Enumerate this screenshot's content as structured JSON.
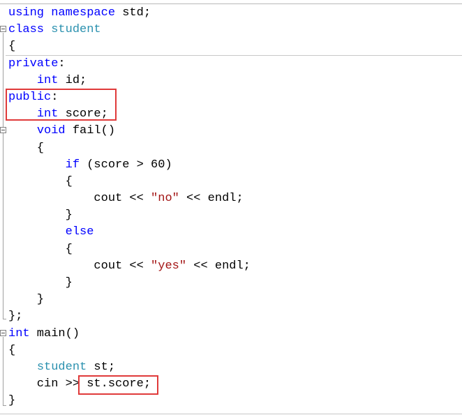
{
  "editor": {
    "lines": [
      {
        "tokens": [
          {
            "t": "using namespace",
            "c": "kw"
          },
          {
            "t": " std;",
            "c": "plain"
          }
        ]
      },
      {
        "tokens": [
          {
            "t": "class",
            "c": "kw"
          },
          {
            "t": " ",
            "c": "plain"
          },
          {
            "t": "student",
            "c": "type"
          }
        ]
      },
      {
        "tokens": [
          {
            "t": "{",
            "c": "plain"
          }
        ]
      },
      {
        "tokens": [
          {
            "t": "private",
            "c": "kw"
          },
          {
            "t": ":",
            "c": "plain"
          }
        ]
      },
      {
        "tokens": [
          {
            "t": "    ",
            "c": "plain"
          },
          {
            "t": "int",
            "c": "kw"
          },
          {
            "t": " id;",
            "c": "plain"
          }
        ]
      },
      {
        "tokens": [
          {
            "t": "public",
            "c": "kw"
          },
          {
            "t": ":",
            "c": "plain"
          }
        ]
      },
      {
        "tokens": [
          {
            "t": "    ",
            "c": "plain"
          },
          {
            "t": "int",
            "c": "kw"
          },
          {
            "t": " score;",
            "c": "plain"
          }
        ]
      },
      {
        "tokens": [
          {
            "t": "    ",
            "c": "plain"
          },
          {
            "t": "void",
            "c": "kw"
          },
          {
            "t": " fail()",
            "c": "plain"
          }
        ]
      },
      {
        "tokens": [
          {
            "t": "    {",
            "c": "plain"
          }
        ]
      },
      {
        "tokens": [
          {
            "t": "        ",
            "c": "plain"
          },
          {
            "t": "if",
            "c": "kw"
          },
          {
            "t": " (score > 60)",
            "c": "plain"
          }
        ]
      },
      {
        "tokens": [
          {
            "t": "        {",
            "c": "plain"
          }
        ]
      },
      {
        "tokens": [
          {
            "t": "            cout << ",
            "c": "plain"
          },
          {
            "t": "\"no\"",
            "c": "str"
          },
          {
            "t": " << endl;",
            "c": "plain"
          }
        ]
      },
      {
        "tokens": [
          {
            "t": "        }",
            "c": "plain"
          }
        ]
      },
      {
        "tokens": [
          {
            "t": "        ",
            "c": "plain"
          },
          {
            "t": "else",
            "c": "kw"
          }
        ]
      },
      {
        "tokens": [
          {
            "t": "        {",
            "c": "plain"
          }
        ]
      },
      {
        "tokens": [
          {
            "t": "            cout << ",
            "c": "plain"
          },
          {
            "t": "\"yes\"",
            "c": "str"
          },
          {
            "t": " << endl;",
            "c": "plain"
          }
        ]
      },
      {
        "tokens": [
          {
            "t": "        }",
            "c": "plain"
          }
        ]
      },
      {
        "tokens": [
          {
            "t": "    }",
            "c": "plain"
          }
        ]
      },
      {
        "tokens": [
          {
            "t": "};",
            "c": "plain"
          }
        ]
      },
      {
        "tokens": [
          {
            "t": "int",
            "c": "kw"
          },
          {
            "t": " main()",
            "c": "plain"
          }
        ]
      },
      {
        "tokens": [
          {
            "t": "{",
            "c": "plain"
          }
        ]
      },
      {
        "tokens": [
          {
            "t": "    ",
            "c": "plain"
          },
          {
            "t": "student",
            "c": "type"
          },
          {
            "t": " st;",
            "c": "plain"
          }
        ]
      },
      {
        "tokens": [
          {
            "t": "    cin >> st.score;",
            "c": "plain"
          }
        ]
      },
      {
        "tokens": [
          {
            "t": "}",
            "c": "plain"
          }
        ]
      }
    ]
  },
  "colors": {
    "keyword": "#0000ff",
    "type": "#2b91af",
    "string": "#a31515",
    "highlight": "#e03a3a"
  }
}
